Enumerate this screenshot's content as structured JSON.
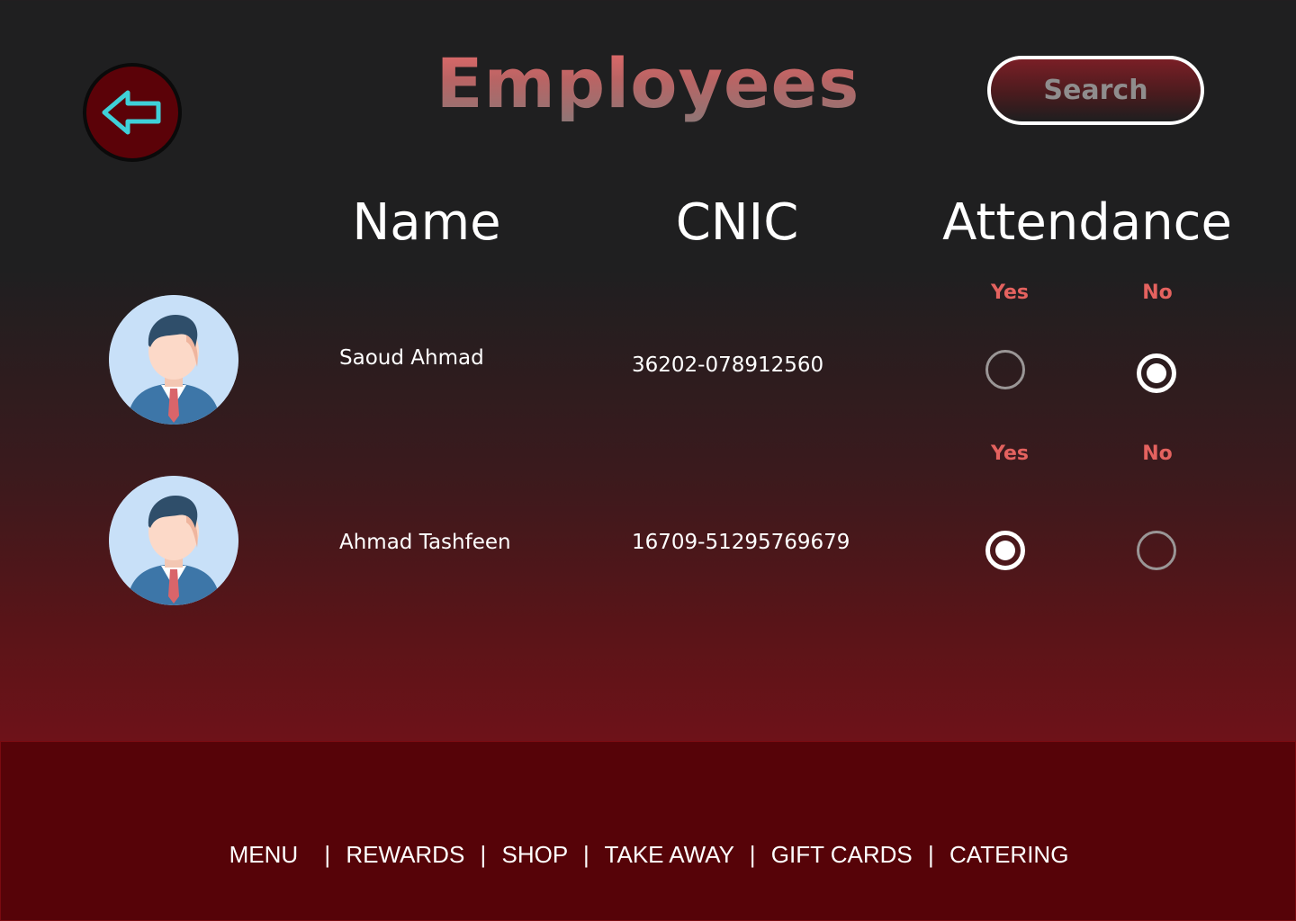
{
  "header": {
    "title": "Employees",
    "search_label": "Search",
    "back_icon": "arrow-left-icon",
    "accent_color": "#e4625f"
  },
  "columns": {
    "name": "Name",
    "cnic": "CNIC",
    "attendance": "Attendance"
  },
  "employees": [
    {
      "name": "Saoud Ahmad",
      "cnic": "36202-078912560",
      "yes_label": "Yes",
      "no_label": "No",
      "attendance": "No"
    },
    {
      "name": "Ahmad Tashfeen",
      "cnic": "16709-51295769679",
      "yes_label": "Yes",
      "no_label": "No",
      "attendance": "Yes"
    }
  ],
  "footer": {
    "nav": [
      "MENU",
      "REWARDS",
      "SHOP",
      "TAKE AWAY",
      "GIFT CARDS",
      "CATERING"
    ],
    "separator": "|"
  }
}
